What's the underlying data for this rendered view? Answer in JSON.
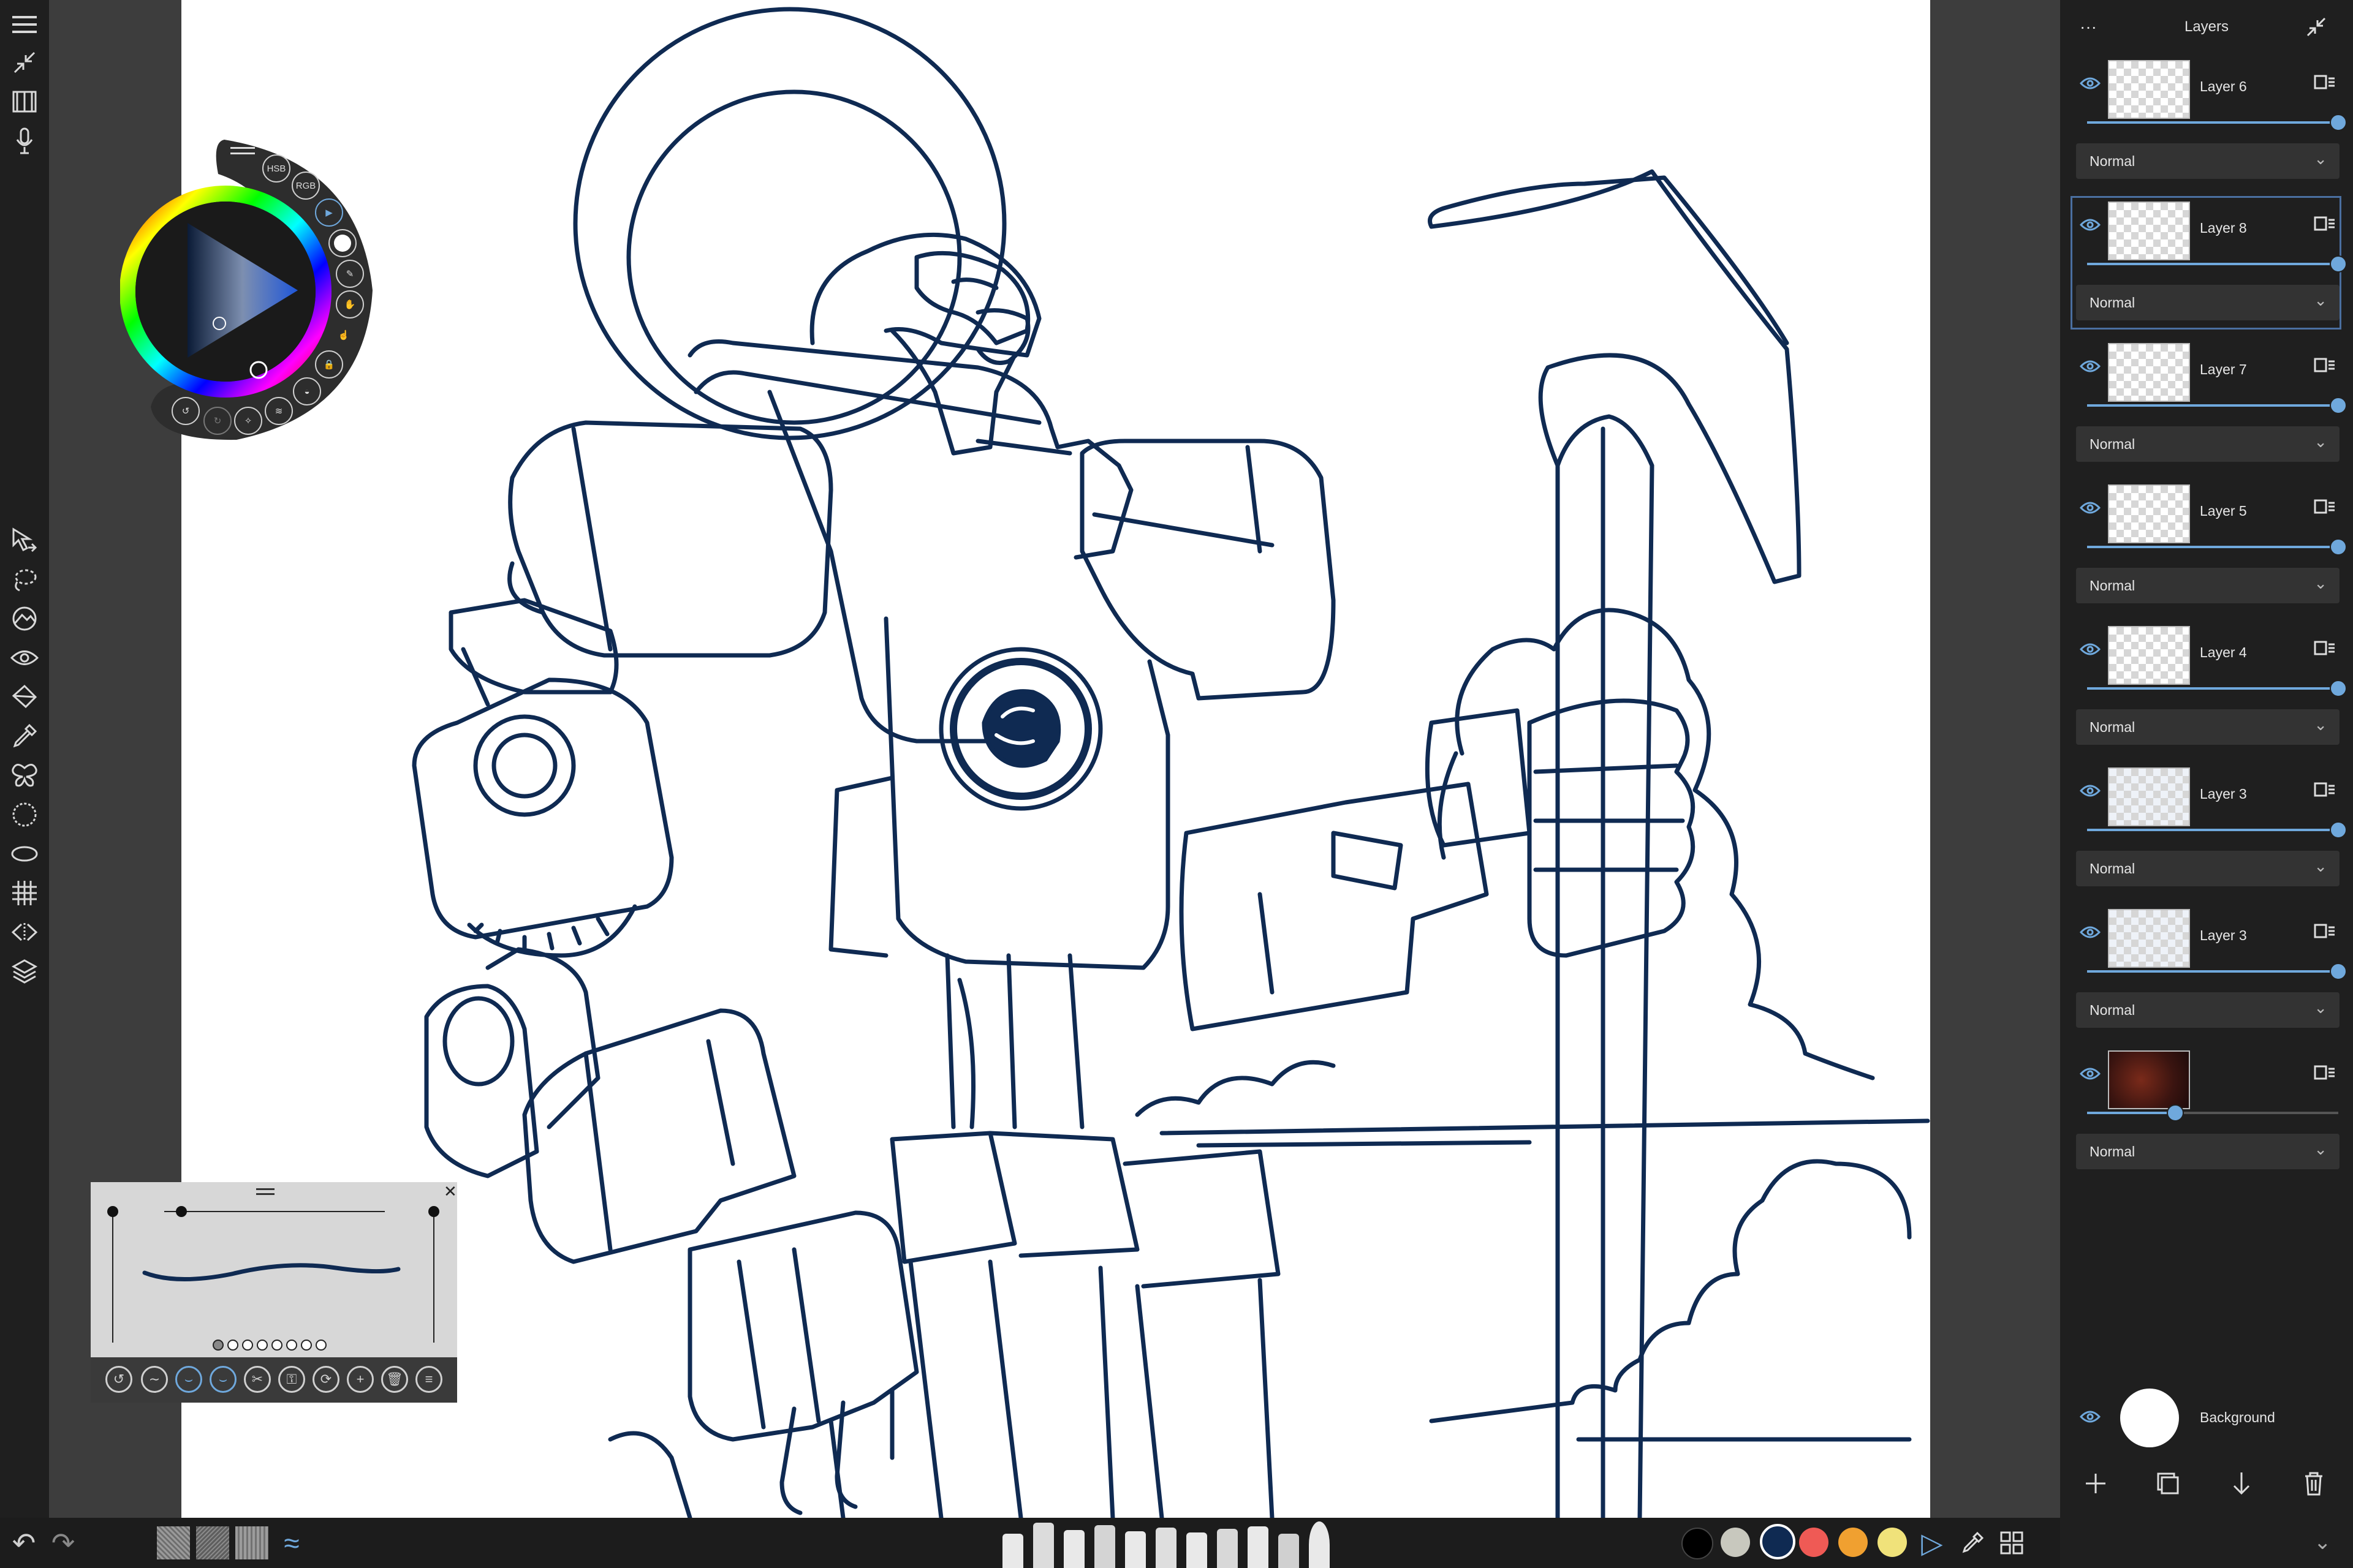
{
  "toolbar": {
    "menu_icon": "☰",
    "collapse_icon": "⤡",
    "book_icon": "📖",
    "mic_icon": "🎙",
    "tools": [
      "select-arrow",
      "lasso",
      "fill-shape",
      "eye",
      "fill-bucket",
      "eyedropper",
      "symmetry-butterfly",
      "ruler-circle",
      "ellipse-guide",
      "perspective-grid",
      "flip",
      "layers"
    ]
  },
  "color_wheel": {
    "labels": [
      "HSB",
      "RGB"
    ],
    "current_color": "#0f2a52",
    "accent": "#6fa8dc"
  },
  "layers_panel": {
    "title": "Layers",
    "more_icon": "···",
    "collapse_icon": "⤡",
    "layers": [
      {
        "name": "Layer 6",
        "blend": "Normal",
        "opacity": 1.0,
        "selected": false,
        "thumb": "empty"
      },
      {
        "name": "Layer 8",
        "blend": "Normal",
        "opacity": 1.0,
        "selected": true,
        "thumb": "empty"
      },
      {
        "name": "Layer 7",
        "blend": "Normal",
        "opacity": 1.0,
        "selected": false,
        "thumb": "empty"
      },
      {
        "name": "Layer 5",
        "blend": "Normal",
        "opacity": 1.0,
        "selected": false,
        "thumb": "empty"
      },
      {
        "name": "Layer 4",
        "blend": "Normal",
        "opacity": 1.0,
        "selected": false,
        "thumb": "empty"
      },
      {
        "name": "Layer 3",
        "blend": "Normal",
        "opacity": 1.0,
        "selected": false,
        "thumb": "sketch"
      },
      {
        "name": "Layer 3",
        "blend": "Normal",
        "opacity": 1.0,
        "selected": false,
        "thumb": "sketch"
      },
      {
        "name": "",
        "blend": "Normal",
        "opacity": 0.35,
        "selected": false,
        "thumb": "painting"
      }
    ],
    "background_label": "Background",
    "actions": [
      "add-layer",
      "duplicate-layer",
      "merge-down",
      "delete-layer"
    ]
  },
  "bottom_bar": {
    "swatches": [
      "#000000",
      "#c8c8be",
      "#0f2a52",
      "#ef5a55",
      "#f0a030",
      "#f0e27a"
    ],
    "selected_swatch": 2
  },
  "brush_editor": {
    "dots_count": 8,
    "stroke_color": "#0f2a52"
  }
}
